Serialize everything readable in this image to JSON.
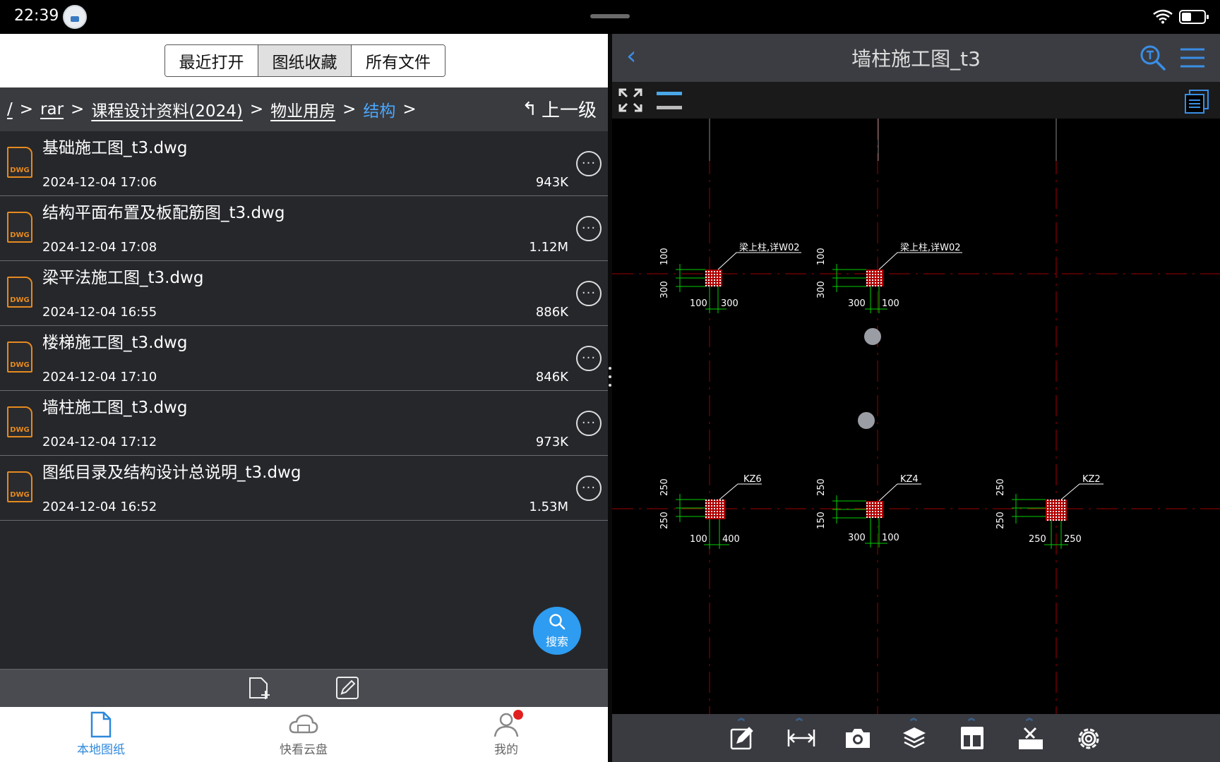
{
  "status": {
    "time": "22:39"
  },
  "left": {
    "tabs": [
      "最近打开",
      "图纸收藏",
      "所有文件"
    ],
    "active_tab": 1,
    "breadcrumb": {
      "root": "/",
      "items": [
        "rar",
        "课程设计资料(2024)",
        "物业用房"
      ],
      "current": "结构",
      "sep": ">"
    },
    "up_level_label": "上一级",
    "files": [
      {
        "name": "基础施工图_t3.dwg",
        "date": "2024-12-04 17:06",
        "size": "943K"
      },
      {
        "name": "结构平面布置及板配筋图_t3.dwg",
        "date": "2024-12-04 17:08",
        "size": "1.12M"
      },
      {
        "name": "梁平法施工图_t3.dwg",
        "date": "2024-12-04 16:55",
        "size": "886K"
      },
      {
        "name": "楼梯施工图_t3.dwg",
        "date": "2024-12-04 17:10",
        "size": "846K"
      },
      {
        "name": "墙柱施工图_t3.dwg",
        "date": "2024-12-04 17:12",
        "size": "973K"
      },
      {
        "name": "图纸目录及结构设计总说明_t3.dwg",
        "date": "2024-12-04 16:52",
        "size": "1.53M"
      }
    ],
    "search_fab_label": "搜索",
    "nav": [
      {
        "label": "本地图纸",
        "icon": "document-icon",
        "active": true
      },
      {
        "label": "快看云盘",
        "icon": "cloud-icon",
        "active": false
      },
      {
        "label": "我的",
        "icon": "user-icon",
        "active": false
      }
    ]
  },
  "right": {
    "title": "墙柱施工图_t3",
    "accent": "#3a8ee6",
    "drawing_labels": {
      "upper_left_callout": "梁上柱,详W02",
      "upper_mid_callout": "梁上柱,详W02",
      "kz6": "KZ6",
      "kz4": "KZ4",
      "kz2": "KZ2",
      "dims": [
        "100",
        "300",
        "100",
        "300",
        "100",
        "300",
        "300",
        "100",
        "250",
        "250",
        "100",
        "400",
        "250",
        "150",
        "300",
        "100",
        "250",
        "250",
        "250",
        "250"
      ]
    },
    "toolbar": [
      "edit-icon",
      "measure-icon",
      "camera-icon",
      "layers-icon",
      "layout-icon",
      "tools-icon",
      "settings-icon"
    ]
  },
  "colors": {
    "left_bg": "#26272b",
    "row_divider": "#6a6b70",
    "dwg_orange": "#e58a1f",
    "fab_blue": "#2e9cf0",
    "cad_green": "#00e000",
    "cad_red": "#c00000"
  }
}
